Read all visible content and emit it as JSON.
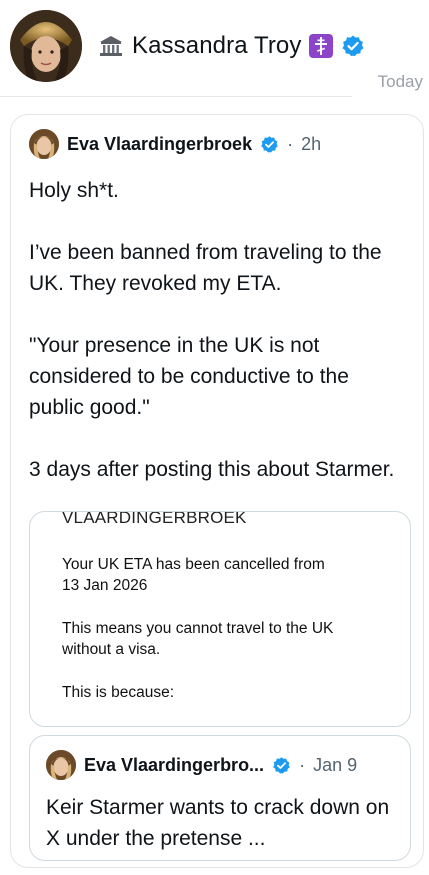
{
  "header": {
    "name": "Kassandra Troy",
    "timestamp": "Today",
    "icons": {
      "left": "classical-building-icon",
      "badge": "orthodox-cross-icon",
      "verified": "verified-badge-icon"
    },
    "colors": {
      "verified_blue": "#1d9bf0",
      "cross_purple": "#8e44c8"
    }
  },
  "post": {
    "author": "Eva Vlaardingerbroek",
    "time_sep": "·",
    "time": "2h",
    "paragraphs": [
      "Holy sh*t.",
      "I’ve been banned from traveling to the UK. They revoked my ETA.",
      "\"Your presence in the UK is not considered to be conductive to the public good.\"",
      "3 days after posting this about Starmer."
    ]
  },
  "notice": {
    "heading": "VLAARDINGERBROEK",
    "line1": "Your UK ETA has been cancelled from",
    "line2": "13 Jan 2026",
    "line3": "This means you cannot travel to the UK",
    "line4": "without a visa.",
    "line5": "This is because:"
  },
  "quote": {
    "author": "Eva Vlaardingerbro...",
    "time_sep": "·",
    "time": "Jan 9",
    "text": "Keir Starmer wants to crack down on X under the pretense ..."
  }
}
